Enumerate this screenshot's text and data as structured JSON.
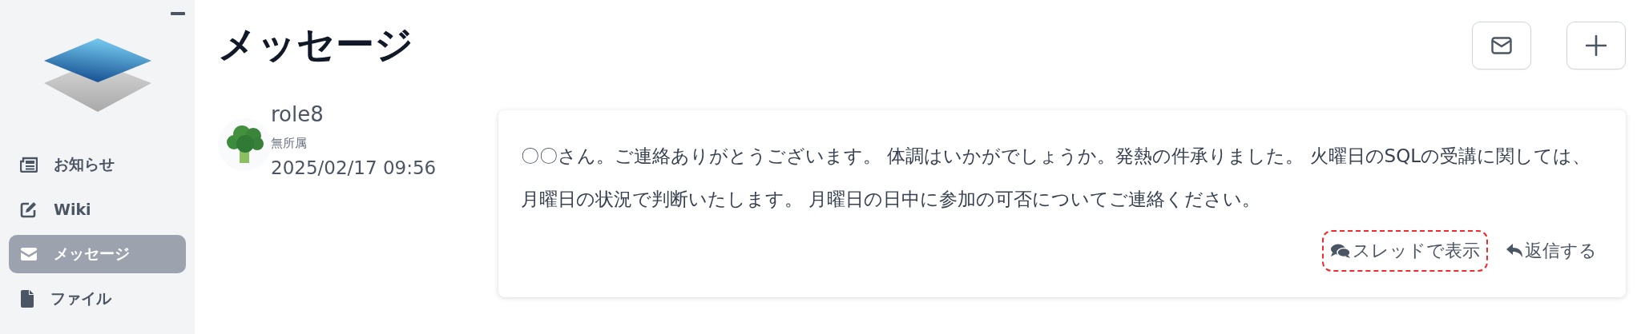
{
  "sidebar": {
    "items": [
      {
        "label": "お知らせ",
        "kind": "news",
        "selected": false
      },
      {
        "label": "Wiki",
        "kind": "edit",
        "selected": false
      },
      {
        "label": "メッセージ",
        "kind": "mail",
        "selected": true
      },
      {
        "label": "ファイル",
        "kind": "file",
        "selected": false
      }
    ]
  },
  "page": {
    "title": "メッセージ"
  },
  "messages": [
    {
      "author": "role8",
      "affiliation": "無所属",
      "timestamp": "2025/02/17 09:56",
      "body": "〇〇さん。ご連絡ありがとうございます。 体調はいかがでしょうか。発熱の件承りました。 火曜日のSQLの受講に関しては、月曜日の状況で判断いたします。 月曜日の日中に参加の可否についてご連絡ください。",
      "actions": [
        {
          "label": "スレッドで表示",
          "kind": "thread",
          "highlighted": true
        },
        {
          "label": "返信する",
          "kind": "reply",
          "highlighted": false
        }
      ]
    }
  ]
}
